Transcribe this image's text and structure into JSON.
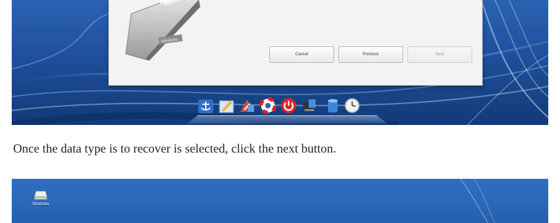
{
  "wizard": {
    "buttons": {
      "cancel": "Cancel",
      "previous": "Previous",
      "next": "Next"
    },
    "next_enabled": false,
    "drive_badge": "Windows"
  },
  "dock": {
    "icons": [
      "anchor-icon",
      "notes-icon",
      "recovery-icon",
      "lifebuoy-icon",
      "power-icon",
      "network-icon",
      "database-icon",
      "clock-icon"
    ]
  },
  "instruction": "Once the data type is to recover is selected, click the next button.",
  "desktop": {
    "icon_label": "Windows",
    "icon": "drive-icon"
  },
  "colors": {
    "desktop_blue": "#1f4f9c",
    "dialog_bg": "#f3f3f3"
  }
}
